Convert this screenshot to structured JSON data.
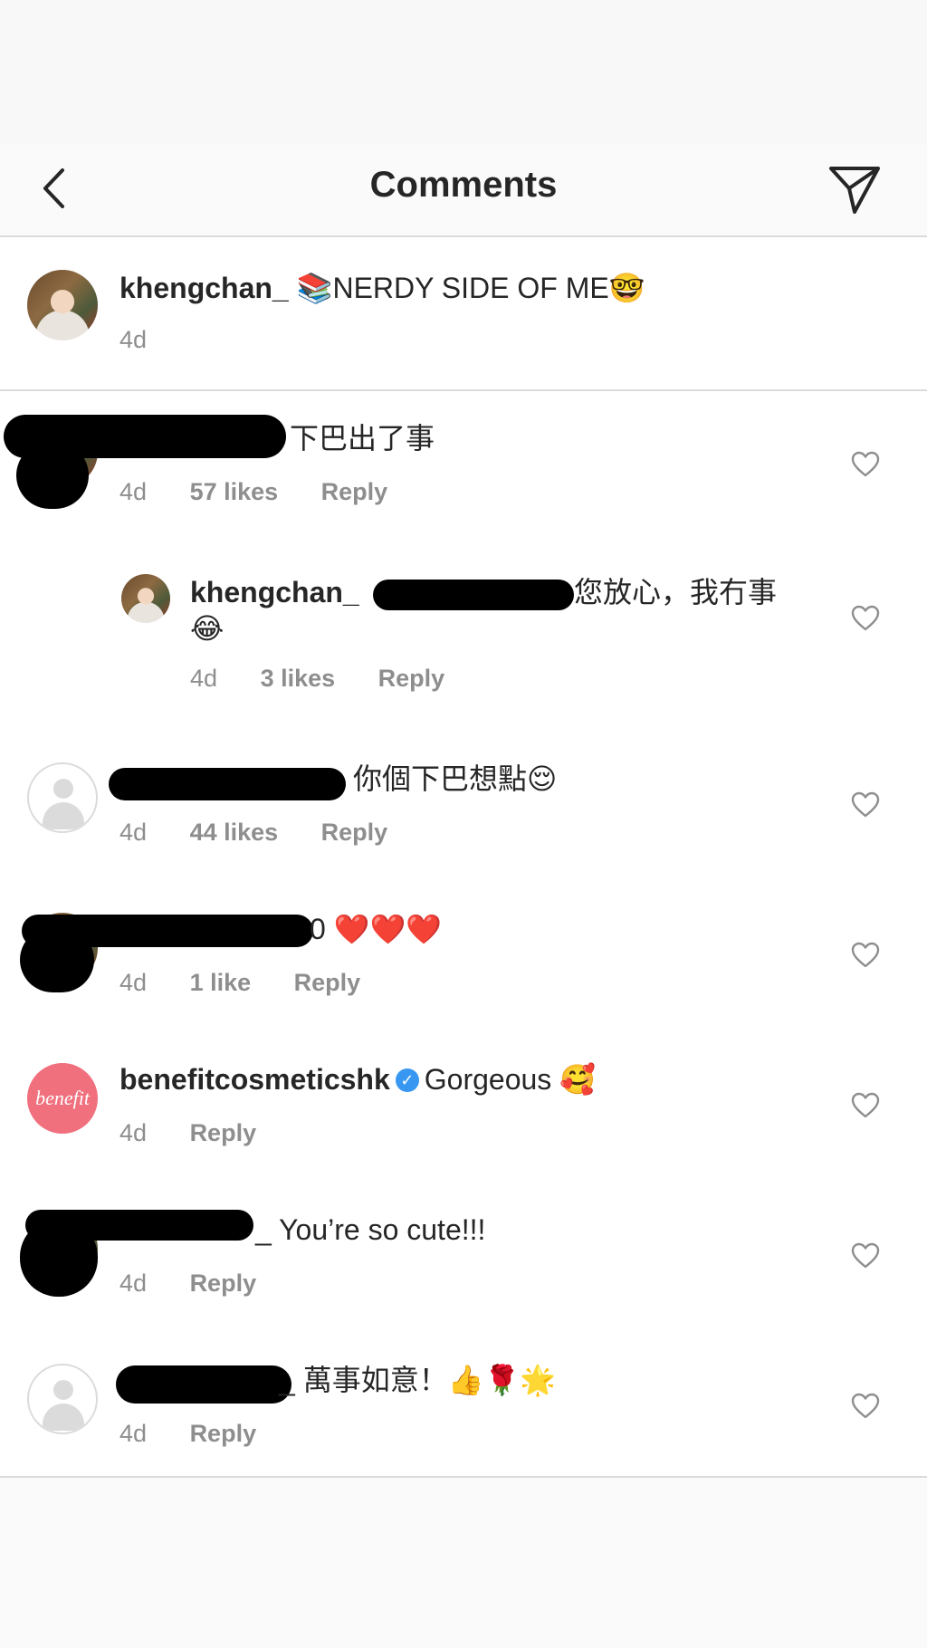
{
  "header": {
    "title": "Comments",
    "back_icon": "chevron-left-icon",
    "share_icon": "paper-plane-icon"
  },
  "caption": {
    "username": "khengchan_",
    "text": "📚NERDY SIDE OF ME🤓",
    "time": "4d"
  },
  "comments": [
    {
      "text": "下巴出了事",
      "time": "4d",
      "likes": "57 likes",
      "reply": "Reply"
    },
    {
      "username": "khengchan_",
      "text": "您放心，我冇事",
      "text2": "😂",
      "time": "4d",
      "likes": "3 likes",
      "reply": "Reply"
    },
    {
      "text": "你個下巴想點😌",
      "time": "4d",
      "likes": "44 likes",
      "reply": "Reply"
    },
    {
      "text": "0 ❤️❤️❤️",
      "time": "4d",
      "likes": "1 like",
      "reply": "Reply"
    },
    {
      "username": "benefitcosmeticshk",
      "avatar_text": "benefit",
      "text": "Gorgeous 🥰",
      "time": "4d",
      "reply": "Reply"
    },
    {
      "text": "_ You’re so cute!!!",
      "time": "4d",
      "reply": "Reply"
    },
    {
      "text": "_ 萬事如意！👍🌹🌟",
      "time": "4d",
      "reply": "Reply"
    }
  ],
  "colors": {
    "text": "#262626",
    "meta": "#8e8e8e",
    "divider": "#dbdbdb",
    "verified": "#3897f0",
    "benefit_pink": "#f0707e"
  }
}
